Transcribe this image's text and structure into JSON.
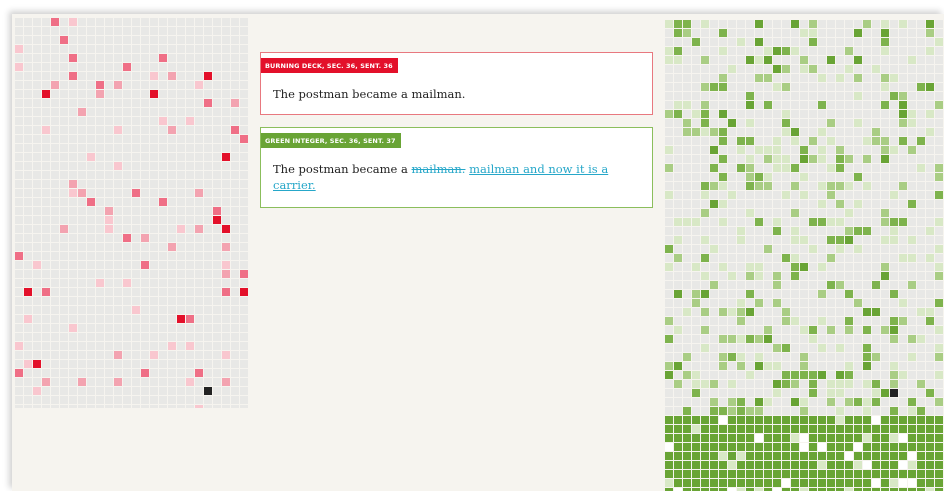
{
  "colors": {
    "red_accent": "#e3102a",
    "green_accent": "#69a435",
    "link_blue": "#26a7c9",
    "grid_empty": "#e8e8e6",
    "grid_current": "#222222"
  },
  "left_grid": {
    "cols": 26,
    "rows": 44,
    "empty_color": "#e8e8e6",
    "cell_colors": [
      "#f9c7cf",
      "#f3a3b0",
      "#ef6f86",
      "#e3102a"
    ],
    "current_color": "#222222"
  },
  "right_grid": {
    "cols": 31,
    "rows": 54,
    "empty_color": "#e8e8e6",
    "cell_colors": [
      "#d8e8c6",
      "#a9cd84",
      "#7eb34d",
      "#69a435"
    ],
    "current_color": "#222222"
  },
  "comparison_a": {
    "tag": "BURNING DECK, SEC. 36, SENT. 36",
    "text": "The postman became a mailman."
  },
  "comparison_b": {
    "tag": "GREEN INTEGER, SEC. 36, SENT. 37",
    "text_prefix": "The postman became a ",
    "deleted": "mailman.",
    "inserted": "mailman and now it is a carrier."
  }
}
